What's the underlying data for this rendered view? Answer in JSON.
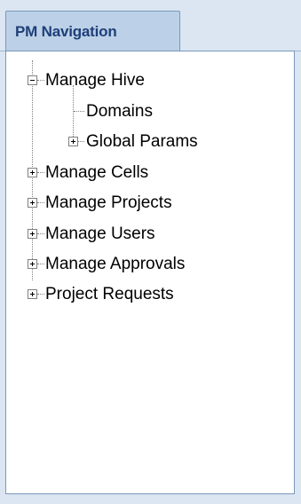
{
  "tab": {
    "label": "PM Navigation"
  },
  "tree": {
    "items": [
      {
        "label": "Manage Hive",
        "state": "expanded",
        "expander_icon": "collapse-icon"
      },
      {
        "label": "Domains",
        "state": "leaf"
      },
      {
        "label": "Global Params",
        "state": "collapsed",
        "expander_icon": "expand-icon"
      },
      {
        "label": "Manage Cells",
        "state": "collapsed",
        "expander_icon": "expand-icon"
      },
      {
        "label": "Manage Projects",
        "state": "collapsed",
        "expander_icon": "expand-icon"
      },
      {
        "label": "Manage Users",
        "state": "collapsed",
        "expander_icon": "expand-icon"
      },
      {
        "label": "Manage Approvals",
        "state": "collapsed",
        "expander_icon": "expand-icon"
      },
      {
        "label": "Project Requests",
        "state": "collapsed",
        "expander_icon": "expand-icon"
      }
    ]
  },
  "colors": {
    "background": "#dbe6f2",
    "tab_fill": "#bcd1e7",
    "tab_text": "#1f3f7a",
    "border": "#7a98b8",
    "tree_lines": "#808080"
  }
}
